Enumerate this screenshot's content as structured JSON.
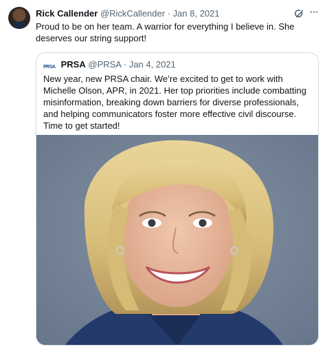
{
  "tweet": {
    "author_name": "Rick Callender",
    "author_handle": "@RickCallender",
    "separator": "·",
    "date": "Jan 8, 2021",
    "text": "Proud to be on her team.  A warrior for everything I believe in.  She deserves our string support!",
    "more_label": "···",
    "icons": {
      "avatar": "profile-photo",
      "grok": "grok-icon",
      "more": "more-icon"
    }
  },
  "quote": {
    "logo_text": "PRSA",
    "author_name": "PRSA",
    "author_handle": "@PRSA",
    "separator": "·",
    "date": "Jan 4, 2021",
    "text": "New year, new PRSA chair. We’re excited to get to work with Michelle Olson, APR, in 2021. Her top priorities include combatting misinformation, breaking down barriers for diverse professionals, and helping communicators foster more effective civil discourse. Time to get started!"
  },
  "colors": {
    "text_primary": "#0f1419",
    "text_secondary": "#536471",
    "border": "#cfd9de",
    "prsa_blue": "#1b4b8f"
  }
}
